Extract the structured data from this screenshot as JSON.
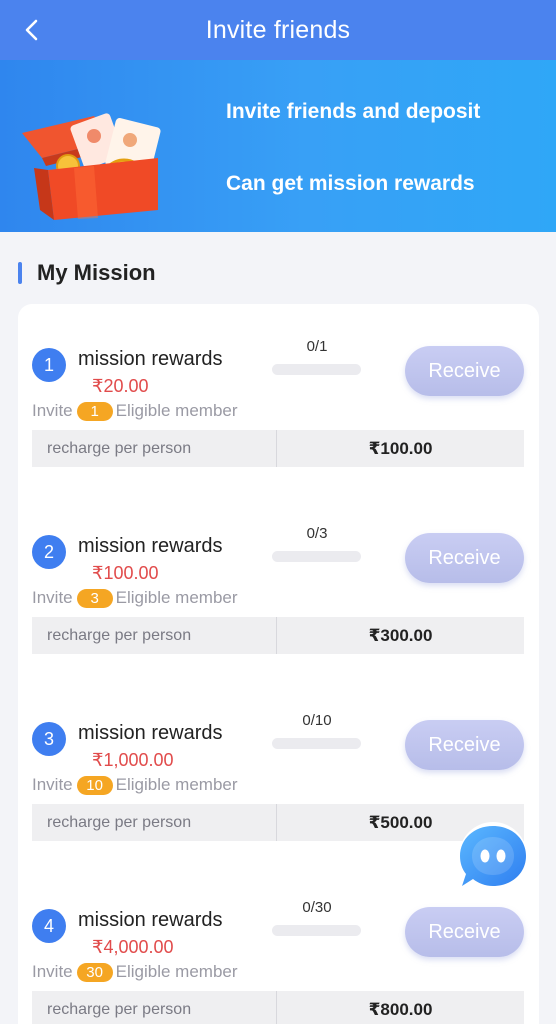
{
  "header": {
    "title": "Invite friends",
    "back_icon": "chevron-left-icon"
  },
  "banner": {
    "line1": "Invite friends and deposit",
    "line2": "Can get mission rewards",
    "image": "gift-box-illustration"
  },
  "section": {
    "title": "My Mission"
  },
  "missions": [
    {
      "number": "1",
      "title": "mission rewards",
      "reward": "₹20.00",
      "invite_prefix": "Invite",
      "invite_count": "1",
      "invite_suffix": "Eligible member",
      "progress_text": "0/1",
      "progress": 0,
      "receive_label": "Receive",
      "recharge_label": "recharge per person",
      "recharge_value": "₹100.00"
    },
    {
      "number": "2",
      "title": "mission rewards",
      "reward": "₹100.00",
      "invite_prefix": "Invite",
      "invite_count": "3",
      "invite_suffix": "Eligible member",
      "progress_text": "0/3",
      "progress": 0,
      "receive_label": "Receive",
      "recharge_label": "recharge per person",
      "recharge_value": "₹300.00"
    },
    {
      "number": "3",
      "title": "mission rewards",
      "reward": "₹1,000.00",
      "invite_prefix": "Invite",
      "invite_count": "10",
      "invite_suffix": "Eligible member",
      "progress_text": "0/10",
      "progress": 0,
      "receive_label": "Receive",
      "recharge_label": "recharge per person",
      "recharge_value": "₹500.00"
    },
    {
      "number": "4",
      "title": "mission rewards",
      "reward": "₹4,000.00",
      "invite_prefix": "Invite",
      "invite_count": "30",
      "invite_suffix": "Eligible member",
      "progress_text": "0/30",
      "progress": 0,
      "receive_label": "Receive",
      "recharge_label": "recharge per person",
      "recharge_value": "₹800.00"
    }
  ],
  "chat": {
    "icon": "chat-bot-icon"
  },
  "colors": {
    "header": "#4b83ee",
    "accent": "#3f7ef0",
    "reward_text": "#e14b4b",
    "pill": "#f5a623",
    "receive_button": "#c1c6ef"
  }
}
